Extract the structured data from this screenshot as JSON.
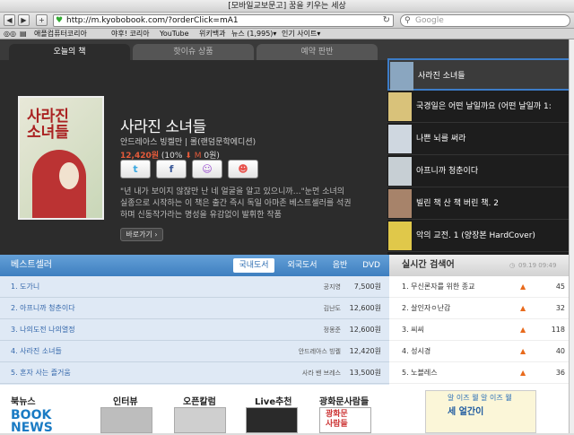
{
  "window": {
    "title": "[모바일교보문고] 꿈을 키우는 세상"
  },
  "toolbar": {
    "back": "◀",
    "forward": "▶",
    "add": "+",
    "url": "http://m.kyobobook.com/?orderClick=mA1",
    "search_placeholder": "Google"
  },
  "bookmarks": [
    "애플컴퓨터코리아",
    "야후! 코리아",
    "YouTube",
    "위키백과",
    "뉴스 (1,995)▾",
    "인기 사이트▾"
  ],
  "hero": {
    "tabs": [
      "오늘의 책",
      "핫이슈 상품",
      "예약 판반"
    ],
    "book": {
      "cover_text": "사라진\n소녀들",
      "title": "사라진 소녀들",
      "author": "안드레아스 빙켈만 | 롤(랜덤문학에디션)",
      "price": "12,420원",
      "discount": "(10%",
      "mileage": "M",
      "mileage_tail": "0원)",
      "description": "\"년 내가 보이지 않잖만 난 네 얼굴을 알고 있으니까…\"눈먼 소녀의 실종으로 시작하는 이 책은 출간 즉시 독일 아마존 베스트셀러를 석권하며 신동작가라는 명성을 유감없이 발휘한 작품",
      "more_label": "바로가기 ›"
    },
    "share_icons": [
      "twitter-icon",
      "facebook-icon",
      "me2day-icon",
      "yozm-icon"
    ],
    "side_list": [
      {
        "title": "사라진 소녀들",
        "thumb": "#8aa6c0"
      },
      {
        "title": "국경일은 어떤 날일까요 (어떤 날일까 1:",
        "thumb": "#d9c27a"
      },
      {
        "title": "나쁜 뇌를 써라",
        "thumb": "#cfd7e0"
      },
      {
        "title": "아프니까 청춘이다",
        "thumb": "#c7cfd4"
      },
      {
        "title": "빌린 책 산 책 버린 책. 2",
        "thumb": "#a7836a"
      },
      {
        "title": "악의 교전. 1 (양장본 HardCover)",
        "thumb": "#e0c84a"
      }
    ]
  },
  "bestseller": {
    "heading": "베스트셀러",
    "tabs": [
      "국내도서",
      "외국도서",
      "음반",
      "DVD"
    ],
    "rows": [
      {
        "title": "1. 도가니",
        "author": "공지영",
        "price": "7,500원"
      },
      {
        "title": "2. 아프니까 청춘이다",
        "author": "김난도",
        "price": "12,600원"
      },
      {
        "title": "3. 나의도전 나의열정",
        "author": "정몽준",
        "price": "12,600원"
      },
      {
        "title": "4. 사라진 소녀들",
        "author": "안드레아스 빙켈",
        "price": "12,420원"
      },
      {
        "title": "5. 혼자 사는 즐거움",
        "author": "사라 밴 브레스",
        "price": "13,500원"
      }
    ]
  },
  "realtime": {
    "heading": "실시간 검색어",
    "time": "09.19 09:49",
    "rows": [
      {
        "term": "1. 무신론자를 위한 종교",
        "count": "45"
      },
      {
        "term": "2. 살인자ㅇ난감",
        "count": "32"
      },
      {
        "term": "3. 씨씨",
        "count": "118"
      },
      {
        "term": "4. 성시경",
        "count": "40"
      },
      {
        "term": "5. 노블레스",
        "count": "36"
      }
    ],
    "arrow": "▲"
  },
  "footer": {
    "sections": [
      "북뉴스",
      "인터뷰",
      "오픈칼럼",
      "Live추천",
      "광화문사람들"
    ],
    "news_logo": "BOOK\nNEWS",
    "gwanghwamun": "광화문\n사람들",
    "ad_line1": "알 이즈 웰 알 이즈 웰",
    "ad_line2": "세 얼간이"
  },
  "colors": {
    "accent": "#3e7fc0",
    "price": "#e45a3a",
    "hero_bg": "#2c2c2c"
  }
}
